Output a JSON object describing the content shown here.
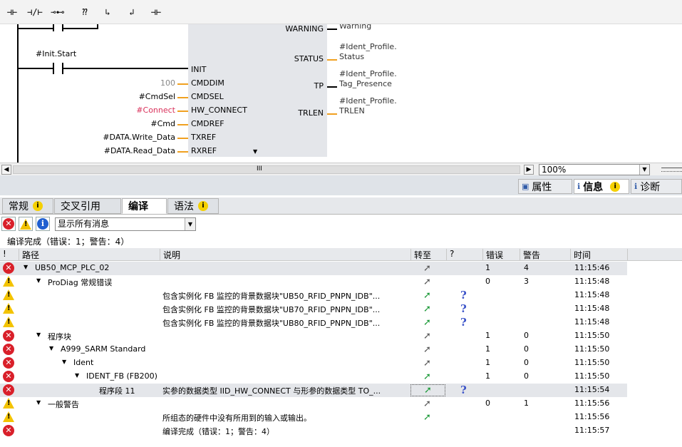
{
  "toolbar": {
    "buttons": [
      {
        "name": "no-contact-button",
        "glyph": "⊣⊢"
      },
      {
        "name": "nc-contact-button",
        "glyph": "⊣/⊢"
      },
      {
        "name": "coil-button",
        "glyph": "⊸⊷"
      },
      {
        "name": "box-button",
        "glyph": "⁇"
      },
      {
        "name": "branch-open-button",
        "glyph": "↳"
      },
      {
        "name": "branch-close-button",
        "glyph": "↲"
      },
      {
        "name": "connection-button",
        "glyph": "⊣⊢"
      }
    ]
  },
  "ladder": {
    "contact_label": "#Init.Start",
    "inputs": [
      {
        "param": "",
        "pin": "INIT"
      },
      {
        "param": "100",
        "pin": "CMDDIM"
      },
      {
        "param": "#CmdSel",
        "pin": "CMDSEL"
      },
      {
        "param": "#Connect",
        "pin": "HW_CONNECT"
      },
      {
        "param": "#Cmd",
        "pin": "CMDREF"
      },
      {
        "param": "#DATA.Write_Data",
        "pin": "TXREF"
      },
      {
        "param": "#DATA.Read_Data",
        "pin": "RXREF"
      }
    ],
    "outputs": [
      {
        "pin": "WARNING",
        "line1": "Warning",
        "line2": ""
      },
      {
        "pin": "STATUS",
        "line1": "#Ident_Profile.",
        "line2": "Status"
      },
      {
        "pin": "TP",
        "line1": "#Ident_Profile.",
        "line2": "Tag_Presence"
      },
      {
        "pin": "TRLEN",
        "line1": "#Ident_Profile.",
        "line2": "TRLEN"
      }
    ],
    "colors": {
      "wire": "#f0a020",
      "connect_param": "#d9305a",
      "constant": "#888888",
      "block": "#e4e6ea"
    }
  },
  "scrollbar": {
    "grip": "III",
    "zoom": "100%"
  },
  "inspector_tabs": [
    {
      "label": "属性",
      "icon": "properties-icon"
    },
    {
      "label": "信息",
      "icon": "info-icon"
    },
    {
      "label": "诊断",
      "icon": "diagnostics-icon"
    }
  ],
  "sub_tabs": [
    {
      "label": "常规",
      "badge": true
    },
    {
      "label": "交叉引用",
      "badge": false
    },
    {
      "label": "编译",
      "badge": false,
      "active": true
    },
    {
      "label": "语法",
      "badge": true
    }
  ],
  "filter": {
    "value": "显示所有消息"
  },
  "summary": "编译完成（错误：1；警告：4）",
  "table": {
    "headers": [
      "!",
      "路径",
      "说明",
      "转至",
      "?",
      "错误",
      "警告",
      "时间"
    ],
    "rows": [
      {
        "icon": "error",
        "indent": 0,
        "expand": "▼",
        "path": "UB50_MCP_PLC_02",
        "desc": "",
        "goto": "gray",
        "help": false,
        "errors": "1",
        "warnings": "4",
        "time": "11:15:46",
        "hl": true
      },
      {
        "icon": "warning",
        "indent": 1,
        "expand": "▼",
        "path": "ProDiag 常规错误",
        "desc": "",
        "goto": "gray",
        "help": false,
        "errors": "0",
        "warnings": "3",
        "time": "11:15:48",
        "hl": false
      },
      {
        "icon": "warning",
        "indent": 2,
        "expand": "",
        "path": "",
        "desc": "包含实例化 FB 监控的背景数据块\"UB50_RFID_PNPN_IDB\"...",
        "goto": "green",
        "help": true,
        "errors": "",
        "warnings": "",
        "time": "11:15:48",
        "hl": false
      },
      {
        "icon": "warning",
        "indent": 2,
        "expand": "",
        "path": "",
        "desc": "包含实例化 FB 监控的背景数据块\"UB70_RFID_PNPN_IDB\"...",
        "goto": "green",
        "help": true,
        "errors": "",
        "warnings": "",
        "time": "11:15:48",
        "hl": false
      },
      {
        "icon": "warning",
        "indent": 2,
        "expand": "",
        "path": "",
        "desc": "包含实例化 FB 监控的背景数据块\"UB80_RFID_PNPN_IDB\"...",
        "goto": "green",
        "help": true,
        "errors": "",
        "warnings": "",
        "time": "11:15:48",
        "hl": false
      },
      {
        "icon": "error",
        "indent": 1,
        "expand": "▼",
        "path": "程序块",
        "desc": "",
        "goto": "gray",
        "help": false,
        "errors": "1",
        "warnings": "0",
        "time": "11:15:50",
        "hl": false
      },
      {
        "icon": "error",
        "indent": 2,
        "expand": "▼",
        "path": "A999_SARM Standard",
        "desc": "",
        "goto": "gray",
        "help": false,
        "errors": "1",
        "warnings": "0",
        "time": "11:15:50",
        "hl": false
      },
      {
        "icon": "error",
        "indent": 3,
        "expand": "▼",
        "path": "Ident",
        "desc": "",
        "goto": "gray",
        "help": false,
        "errors": "1",
        "warnings": "0",
        "time": "11:15:50",
        "hl": false
      },
      {
        "icon": "error",
        "indent": 4,
        "expand": "▼",
        "path": "IDENT_FB (FB200)",
        "desc": "",
        "goto": "green",
        "help": false,
        "errors": "1",
        "warnings": "0",
        "time": "11:15:50",
        "hl": false
      },
      {
        "icon": "error",
        "indent": 5,
        "expand": "",
        "path": "程序段 11",
        "desc": "实参的数据类型 IID_HW_CONNECT 与形参的数据类型 TO_...",
        "goto": "green",
        "help": true,
        "errors": "",
        "warnings": "",
        "time": "11:15:54",
        "hl": true
      },
      {
        "icon": "warning",
        "indent": 1,
        "expand": "▼",
        "path": "一般警告",
        "desc": "",
        "goto": "gray",
        "help": false,
        "errors": "0",
        "warnings": "1",
        "time": "11:15:56",
        "hl": false
      },
      {
        "icon": "warning",
        "indent": 2,
        "expand": "",
        "path": "",
        "desc": "所组态的硬件中没有所用到的输入或输出。",
        "goto": "green",
        "help": false,
        "errors": "",
        "warnings": "",
        "time": "11:15:56",
        "hl": false
      },
      {
        "icon": "error",
        "indent": 2,
        "expand": "",
        "path": "",
        "desc": "编译完成（错误：1；警告：4）",
        "goto": "",
        "help": false,
        "errors": "",
        "warnings": "",
        "time": "11:15:57",
        "hl": false
      }
    ]
  }
}
